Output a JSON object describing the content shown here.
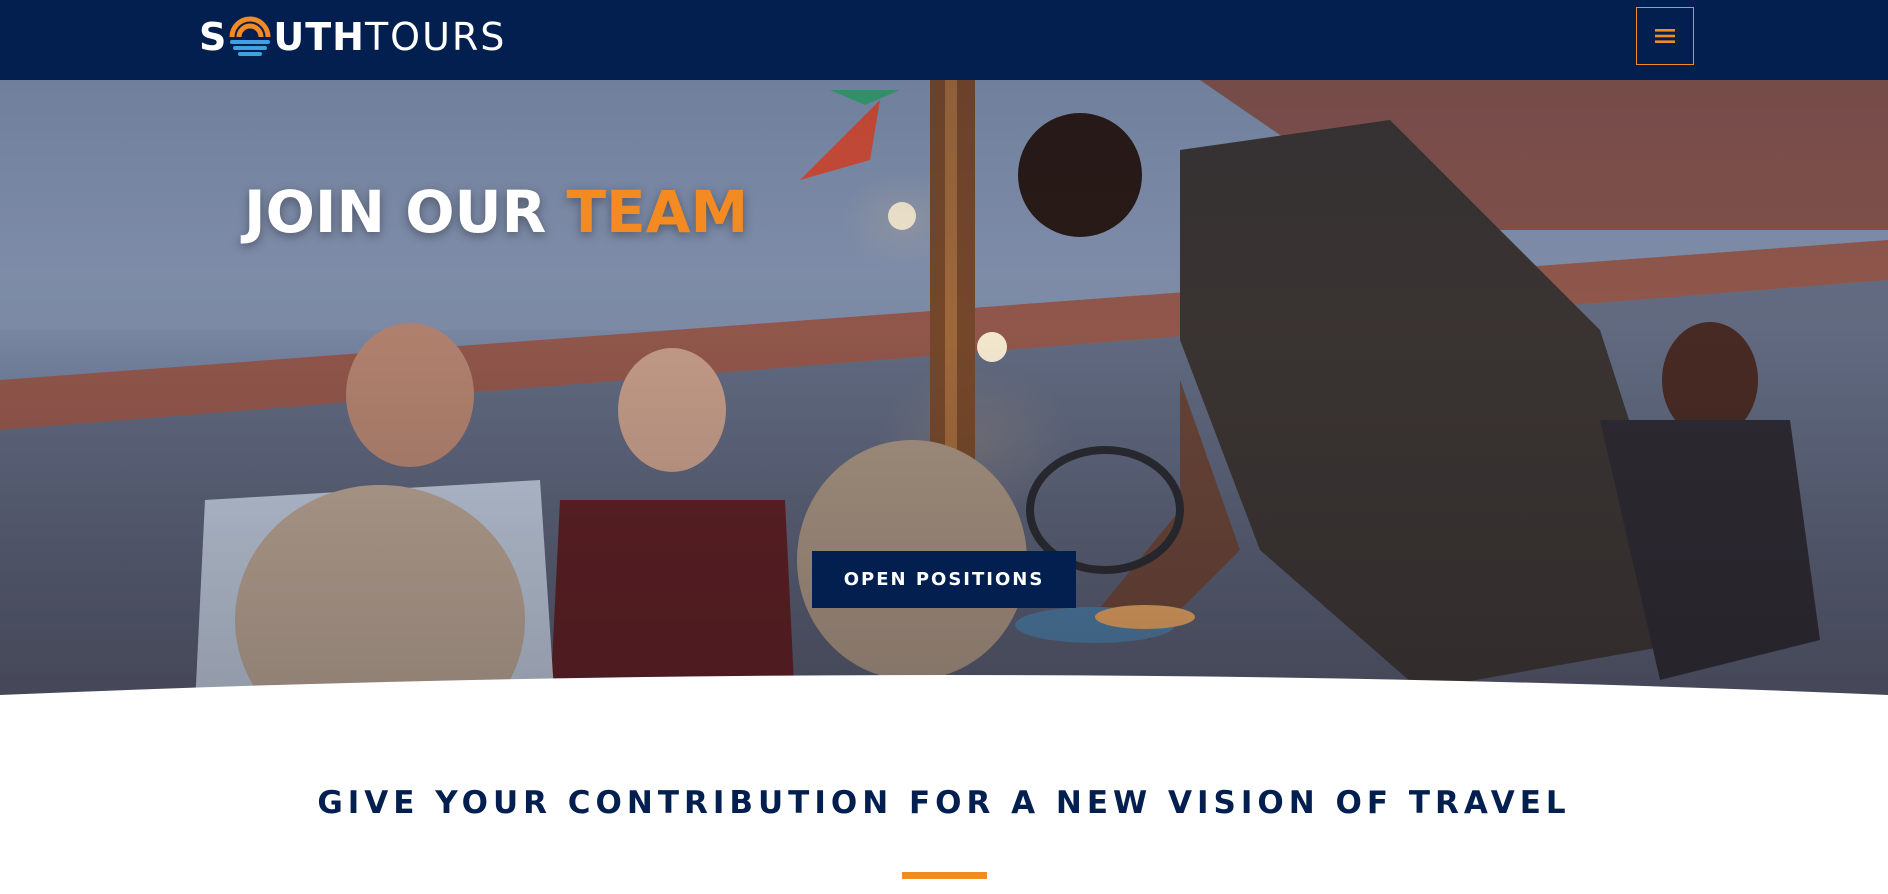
{
  "header": {
    "logo": {
      "bold_prefix": "S",
      "bold_suffix": "UTH",
      "thin": "TOURS",
      "icon": "sun-waves-icon"
    },
    "menu_icon": "hamburger-menu-icon"
  },
  "hero": {
    "title_part1": "JOIN OUR ",
    "title_accent": "TEAM",
    "cta_label": "OPEN POSITIONS"
  },
  "content": {
    "heading": "GIVE YOUR CONTRIBUTION FOR A NEW VISION OF TRAVEL"
  },
  "colors": {
    "navy": "#031f4f",
    "orange": "#f38a22",
    "white": "#ffffff"
  }
}
